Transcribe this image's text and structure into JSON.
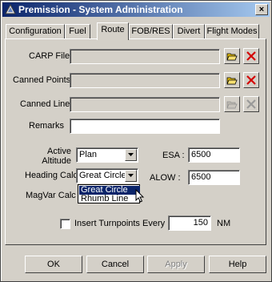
{
  "window": {
    "title": "Premission - System Administration",
    "close": "×"
  },
  "tabs": [
    {
      "label": "Configuration"
    },
    {
      "label": "Fuel"
    },
    {
      "label": "Route"
    },
    {
      "label": "FOB/RES"
    },
    {
      "label": "Divert"
    },
    {
      "label": "Flight Modes"
    }
  ],
  "form": {
    "carp_file_label": "CARP File",
    "carp_file_value": "",
    "canned_points_label": "Canned Points",
    "canned_points_value": "",
    "canned_line_label": "Canned Line",
    "canned_line_value": "",
    "remarks_label": "Remarks",
    "remarks_value": "",
    "active_altitude_label_1": "Active",
    "active_altitude_label_2": "Altitude",
    "active_altitude_value": "Plan",
    "heading_calc_label": "Heading Calc",
    "heading_calc_value": "Great Circle",
    "heading_calc_options": [
      "Great Circle",
      "Rhumb Line"
    ],
    "magvar_calc_label": "MagVar Calc",
    "esa_label": "ESA :",
    "esa_value": "6500",
    "alow_label": "ALOW :",
    "alow_value": "6500",
    "turnpoints_label": "Insert Turnpoints Every :",
    "turnpoints_value": "150",
    "turnpoints_unit": "NM"
  },
  "buttons": {
    "ok": "OK",
    "cancel": "Cancel",
    "apply": "Apply",
    "help": "Help"
  },
  "colors": {
    "title_start": "#0a246a",
    "title_end": "#a6caf0",
    "dialog_bg": "#d4d0c8",
    "selection": "#0a246a",
    "delete_red": "#d40000",
    "folder_yellow": "#e8c000"
  },
  "icons": {
    "open": "folder-open-icon",
    "delete": "delete-x-icon"
  }
}
